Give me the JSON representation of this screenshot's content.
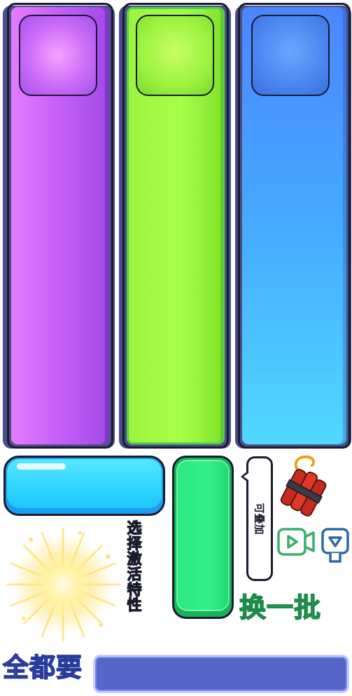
{
  "cards": [
    {
      "id": "purple",
      "color": "#c25cf6"
    },
    {
      "id": "green",
      "color": "#a8ff4a"
    },
    {
      "id": "blue",
      "color": "#46a6ff"
    }
  ],
  "buttons": {
    "cyan_color": "#2fd4ff",
    "green_color": "#35f089"
  },
  "labels": {
    "stackable": "可叠加",
    "select_activate": "选择激活特性",
    "refresh": "换一批",
    "take_all": "全都要"
  },
  "icons": {
    "dynamite": "dynamite-icon",
    "video_ad": "video-play-icon",
    "video_ad_alt": "video-play-icon-alt",
    "burst": "starburst-icon"
  },
  "colors": {
    "refresh_green": "#39d06a",
    "take_all_blue": "#5b86ff",
    "bar_blue": "#5566c8"
  }
}
